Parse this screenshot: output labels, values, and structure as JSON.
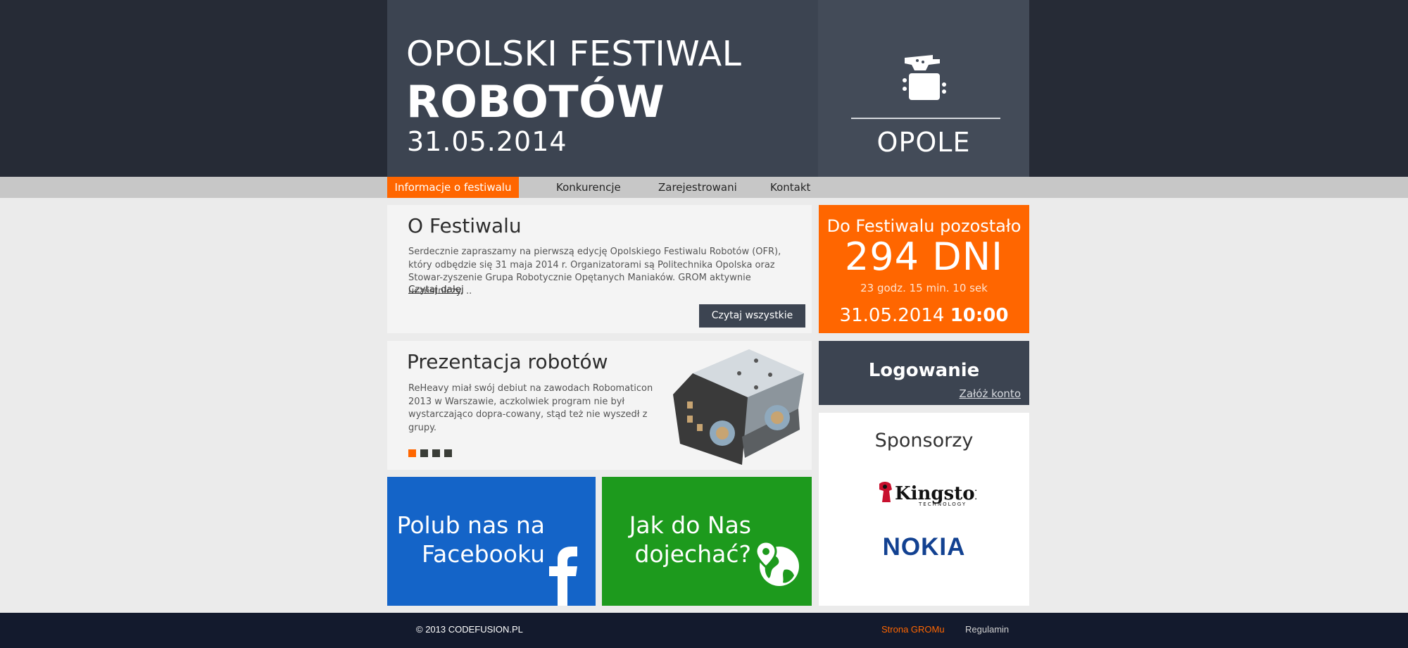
{
  "header": {
    "title_line1": "OPOLSKI FESTIWAL",
    "title_line2": "ROBOTÓW",
    "date": "31.05.2014",
    "city": "OPOLE",
    "logo_icon": "robot-logo-icon"
  },
  "nav": {
    "items": [
      {
        "label": "Informacje o festiwalu",
        "active": true
      },
      {
        "label": "Konkurencje",
        "active": false
      },
      {
        "label": "Zarejestrowani",
        "active": false
      },
      {
        "label": "Kontakt",
        "active": false
      }
    ]
  },
  "about": {
    "title": "O Festiwalu",
    "text": "Serdecznie zapraszamy na pierwszą edycję Opolskiego Festiwalu Robotów (OFR), który odbędzie się 31 maja 2014 r. Organizatorami są Politechnika Opolska oraz Stowar-zyszenie Grupa Robotycznie Opętanych Maniaków. GROM aktywnie uczestniczy. ..",
    "read_more": "Czytaj dalej",
    "button": "Czytaj wszystkie"
  },
  "countdown": {
    "title": "Do Festiwalu pozostało",
    "days": "294 DNI",
    "rest": "23 godz. 15 min. 10 sek",
    "date": "31.05.2014",
    "time": "10:00"
  },
  "robots": {
    "title": "Prezentacja robotów",
    "text": "ReHeavy miał swój debiut na zawodach Robomaticon 2013 w Warszawie, aczkolwiek program nie był wystarczająco dopra-cowany, stąd też nie wyszedł z grupy.",
    "slides": 4,
    "active_slide": 1
  },
  "login": {
    "title": "Logowanie",
    "register": "Załóż konto"
  },
  "facebook": {
    "line1": "Polub nas na",
    "line2": "Facebooku",
    "icon": "facebook-icon"
  },
  "directions": {
    "line1": "Jak do Nas",
    "line2": "dojechać?",
    "icon": "globe-pin-icon"
  },
  "sponsors": {
    "title": "Sponsorzy",
    "items": [
      {
        "name": "Kingston",
        "sub": "TECHNOLOGY"
      },
      {
        "name": "NOKIA"
      }
    ]
  },
  "footer": {
    "copyright": "© 2013 CODEFUSION.PL",
    "links": [
      {
        "label": "Strona GROMu",
        "color": "#ff6600"
      },
      {
        "label": "Regulamin",
        "color": "#d0d0d0"
      }
    ]
  },
  "colors": {
    "accent": "#ff6600",
    "dark": "#3c4451",
    "facebook": "#1464c8",
    "green": "#1d9a1d"
  }
}
